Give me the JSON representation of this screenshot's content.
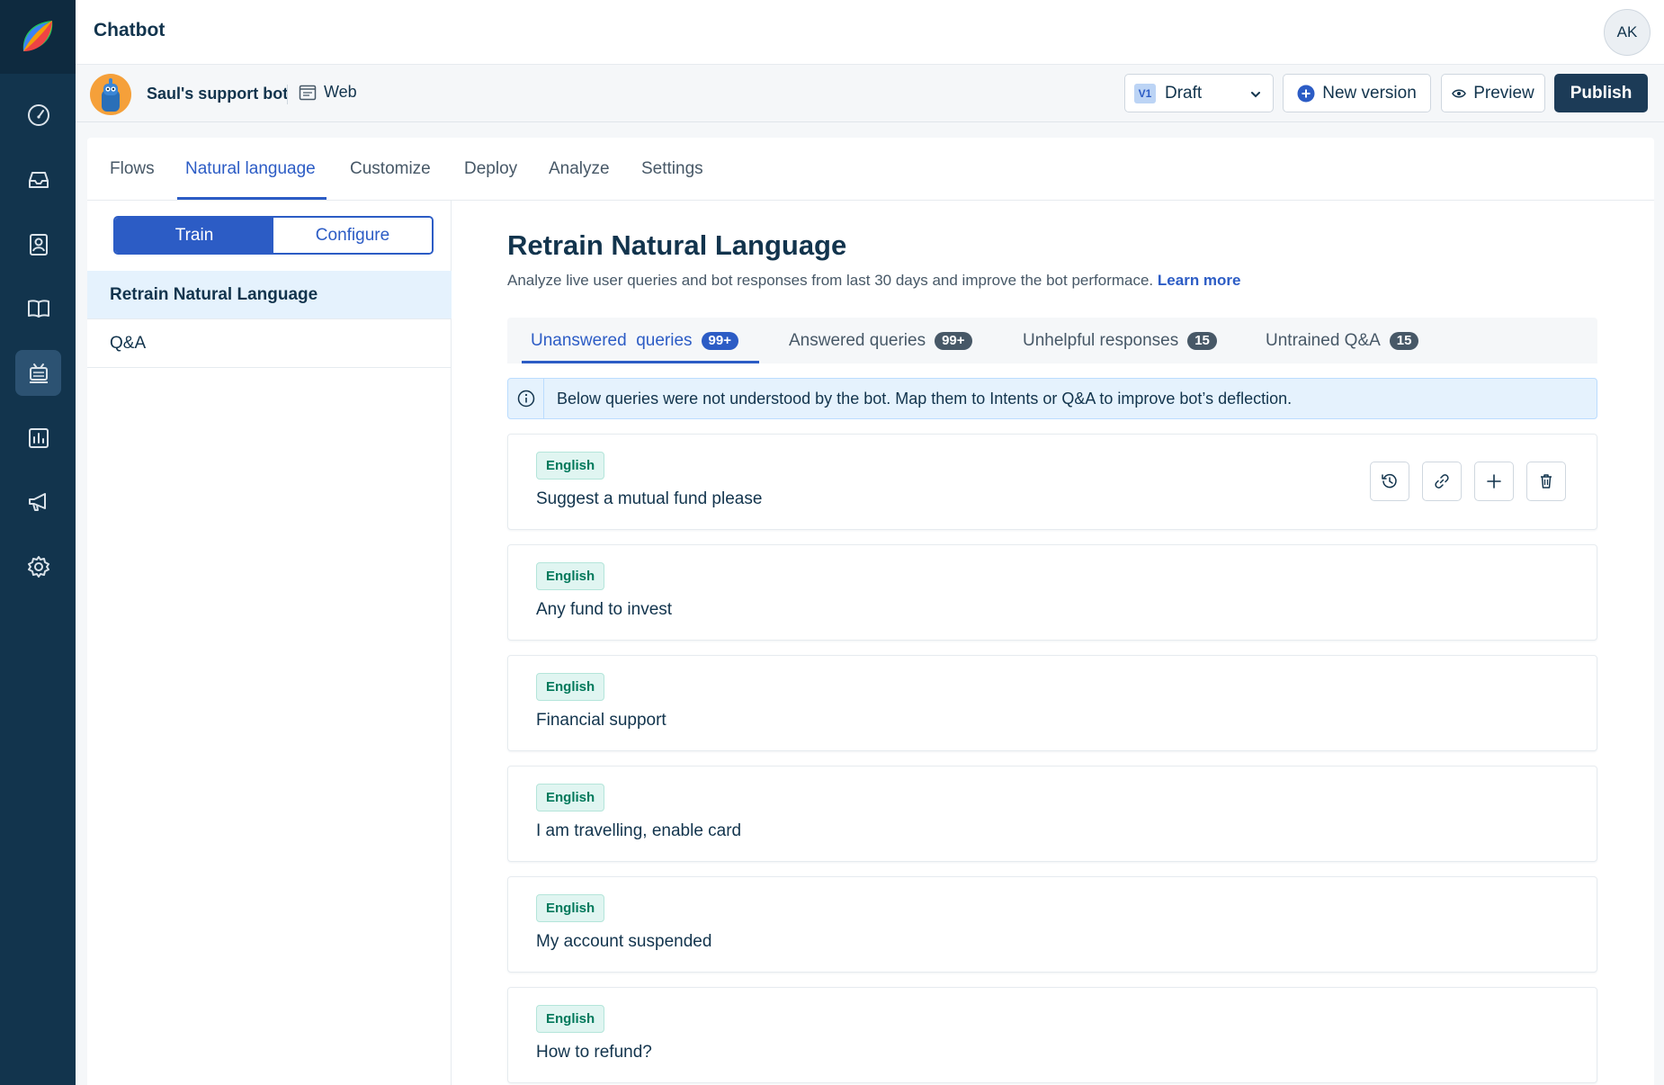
{
  "app": {
    "title": "Chatbot",
    "user_initials": "AK"
  },
  "rail": {
    "items": [
      {
        "icon": "dashboard-icon",
        "active": false
      },
      {
        "icon": "inbox-icon",
        "active": false
      },
      {
        "icon": "contacts-icon",
        "active": false
      },
      {
        "icon": "book-icon",
        "active": false
      },
      {
        "icon": "bot-icon",
        "active": true
      },
      {
        "icon": "analytics-icon",
        "active": false
      },
      {
        "icon": "megaphone-icon",
        "active": false
      },
      {
        "icon": "gear-icon",
        "active": false
      }
    ]
  },
  "bot": {
    "name": "Saul's support bot",
    "channel": "Web"
  },
  "toolbar": {
    "version_badge": "V1",
    "version_label": "Draft",
    "new_version_label": "New version",
    "preview_label": "Preview",
    "publish_label": "Publish"
  },
  "tabs": [
    {
      "label": "Flows",
      "active": false
    },
    {
      "label": "Natural language",
      "active": true
    },
    {
      "label": "Customize",
      "active": false
    },
    {
      "label": "Deploy",
      "active": false
    },
    {
      "label": "Analyze",
      "active": false
    },
    {
      "label": "Settings",
      "active": false
    }
  ],
  "segment": {
    "train": "Train",
    "configure": "Configure",
    "selected": "Train"
  },
  "sidebar": {
    "items": [
      {
        "label": "Retrain Natural Language",
        "active": true
      },
      {
        "label": "Q&A",
        "active": false
      }
    ]
  },
  "main": {
    "title": "Retrain Natural Language",
    "subtitle": "Analyze live user queries and bot responses from last 30 days and improve the bot performace.",
    "learn_more": "Learn more",
    "subtabs": [
      {
        "label": "Unanswered  queries",
        "count": "99+",
        "active": true
      },
      {
        "label": "Answered queries",
        "count": "99+",
        "active": false
      },
      {
        "label": "Unhelpful responses",
        "count": "15",
        "active": false
      },
      {
        "label": "Untrained Q&A",
        "count": "15",
        "active": false
      }
    ],
    "info_text": "Below queries were not understood by the bot. Map them to Intents or Q&A to improve bot’s deflection.",
    "queries": [
      {
        "language": "English",
        "text": "Suggest a mutual fund please"
      },
      {
        "language": "English",
        "text": "Any fund to invest"
      },
      {
        "language": "English",
        "text": "Financial support"
      },
      {
        "language": "English",
        "text": "I am travelling, enable card"
      },
      {
        "language": "English",
        "text": "My account suspended"
      },
      {
        "language": "English",
        "text": "How to refund?"
      }
    ]
  },
  "colors": {
    "rail": "#12344d",
    "accent": "#2c5cc5",
    "publish": "#1c3b57",
    "chip_text": "#00795b"
  }
}
